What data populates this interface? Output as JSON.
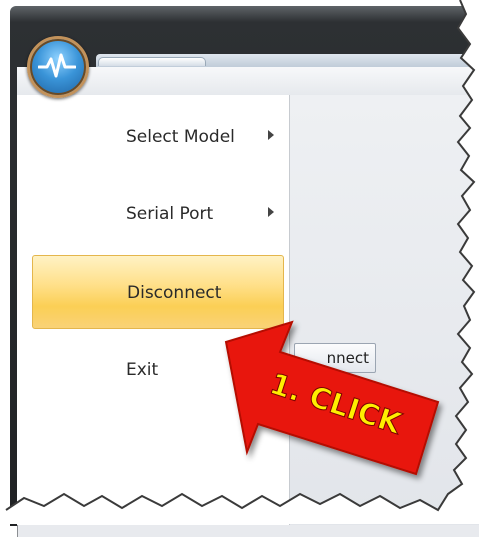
{
  "menu": {
    "items": [
      {
        "label": "Select Model",
        "has_submenu": true
      },
      {
        "label": "Serial Port",
        "has_submenu": true
      },
      {
        "label": "Disconnect",
        "has_submenu": false,
        "highlighted": true
      },
      {
        "label": "Exit",
        "has_submenu": false
      }
    ]
  },
  "right_pane": {
    "button_label": "nnect"
  },
  "annotation": {
    "text": "1. CLICK",
    "color": "#e8170f",
    "text_color": "#ffee00"
  },
  "app_button": {
    "icon": "pulse-icon"
  }
}
